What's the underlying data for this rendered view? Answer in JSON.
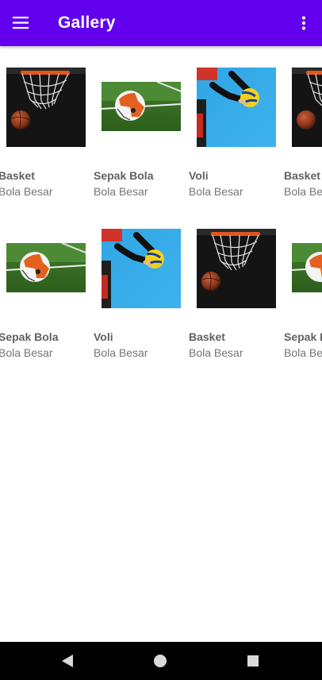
{
  "app_bar": {
    "title": "Gallery",
    "menu_icon": "hamburger-menu-icon",
    "overflow_icon": "more-vert-icon",
    "color": "#6200EE"
  },
  "grid": {
    "rows": [
      {
        "items": [
          {
            "name": "Basket",
            "category": "Bola Besar",
            "image": "basketball-hoop-image"
          },
          {
            "name": "Sepak Bola",
            "category": "Bola Besar",
            "image": "soccer-ball-image"
          },
          {
            "name": "Voli",
            "category": "Bola Besar",
            "image": "volleyball-image"
          },
          {
            "name": "Basket",
            "category": "Bola Besar",
            "image": "basketball-hoop-image"
          }
        ]
      },
      {
        "items": [
          {
            "name": "Sepak Bola",
            "category": "Bola Besar",
            "image": "soccer-ball-image"
          },
          {
            "name": "Voli",
            "category": "Bola Besar",
            "image": "volleyball-image"
          },
          {
            "name": "Basket",
            "category": "Bola Besar",
            "image": "basketball-hoop-image"
          },
          {
            "name": "Sepak Bola",
            "category": "Bola Besar",
            "image": "soccer-ball-image"
          }
        ]
      }
    ]
  },
  "nav_bar": {
    "back_icon": "back-triangle-icon",
    "home_icon": "home-circle-icon",
    "recents_icon": "recents-square-icon"
  }
}
